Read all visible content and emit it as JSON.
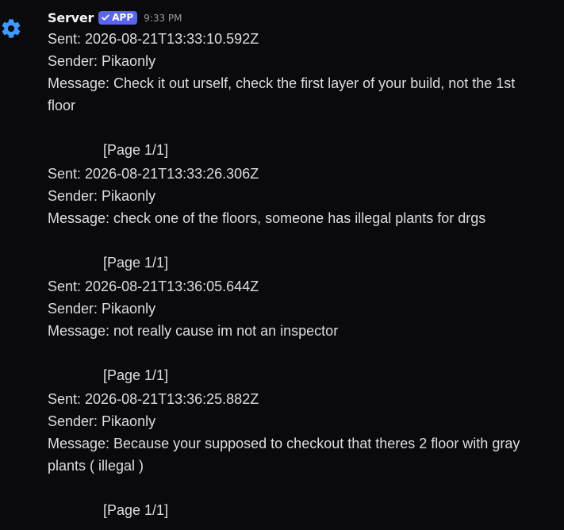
{
  "message": {
    "author": "Server",
    "badge": "APP",
    "timestamp": "9:33 PM",
    "entries": [
      {
        "sent": "Sent: 2026-08-21T13:33:10.592Z",
        "sender": "Sender: Pikaonly",
        "message": "Message: Check it out urself, check the first layer of your build, not the 1st floor",
        "page": "[Page 1/1]"
      },
      {
        "sent": "Sent: 2026-08-21T13:33:26.306Z",
        "sender": "Sender: Pikaonly",
        "message": "Message: check one of the floors, someone has illegal plants for drgs",
        "page": "[Page 1/1]"
      },
      {
        "sent": "Sent: 2026-08-21T13:36:05.644Z",
        "sender": "Sender: Pikaonly",
        "message": "Message: not really cause im not an inspector",
        "page": "[Page 1/1]"
      },
      {
        "sent": "Sent: 2026-08-21T13:36:25.882Z",
        "sender": "Sender: Pikaonly",
        "message": "Message: Because your supposed to checkout that theres 2 floor with gray plants ( illegal )",
        "page": "[Page 1/1]"
      }
    ]
  },
  "colors": {
    "background": "#0a0a0d",
    "avatar": "#3b9bff",
    "badge": "#5865f2",
    "text": "#dbdee1",
    "muted": "#949ba4"
  },
  "icons": {
    "avatar": "gear-icon",
    "badge": "checkmark-icon"
  }
}
